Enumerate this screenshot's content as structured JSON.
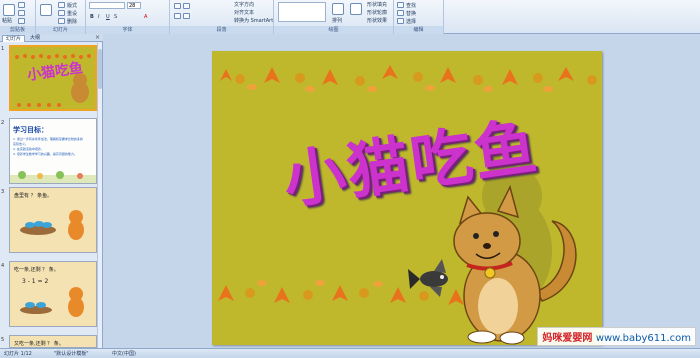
{
  "ribbon": {
    "groups": [
      {
        "label": "剪贴板",
        "items": [
          "粘贴",
          "剪切",
          "复制",
          "格式刷"
        ]
      },
      {
        "label": "幻灯片",
        "items": [
          "新建幻灯片",
          "版式",
          "重设",
          "删除"
        ]
      },
      {
        "label": "字体",
        "font_size": "28",
        "items": [
          "B",
          "I",
          "U",
          "S",
          "A"
        ]
      },
      {
        "label": "段落",
        "items": [
          "文字方向",
          "对齐文本",
          "转换为 SmartArt"
        ]
      },
      {
        "label": "绘图",
        "items": [
          "排列",
          "快速样式",
          "形状填充",
          "形状轮廓",
          "形状效果"
        ]
      },
      {
        "label": "编辑",
        "items": [
          "查找",
          "替换",
          "选择"
        ]
      }
    ]
  },
  "left_pane": {
    "tabs": [
      "幻灯片",
      "大纲"
    ],
    "close_glyph": "×",
    "thumbnails": [
      {
        "number": "1",
        "title": "小猫吃鱼"
      },
      {
        "number": "2",
        "title": "学习目标：",
        "lines": [
          "1. 通过一步有余条件加法，理解和掌握求比较的多的",
          "实际含义。",
          "2. 在实践活动中培养，",
          "3. 培养学生数学学习的兴趣，提高问题的能力。"
        ]
      },
      {
        "number": "3",
        "title": "盘里有 ？ 条鱼。"
      },
      {
        "number": "4",
        "title": "吃一条,还剩 ？ 条。",
        "equation": "3 - 1 = 2"
      },
      {
        "number": "5",
        "title": "又吃一条,还剩 ？ 条。"
      }
    ]
  },
  "slide": {
    "title": "小猫吃鱼"
  },
  "status_bar": {
    "slide_info": "幻灯片 1/12",
    "theme": "\"默认设计模板\"",
    "language": "中文(中国)"
  },
  "watermark": {
    "brand": "妈咪爱婴网",
    "site": "www.baby611.com"
  },
  "colors": {
    "slide_bg": "#bfb82d",
    "title": "#cc33cc",
    "thumb_selected": "#f0a321"
  }
}
